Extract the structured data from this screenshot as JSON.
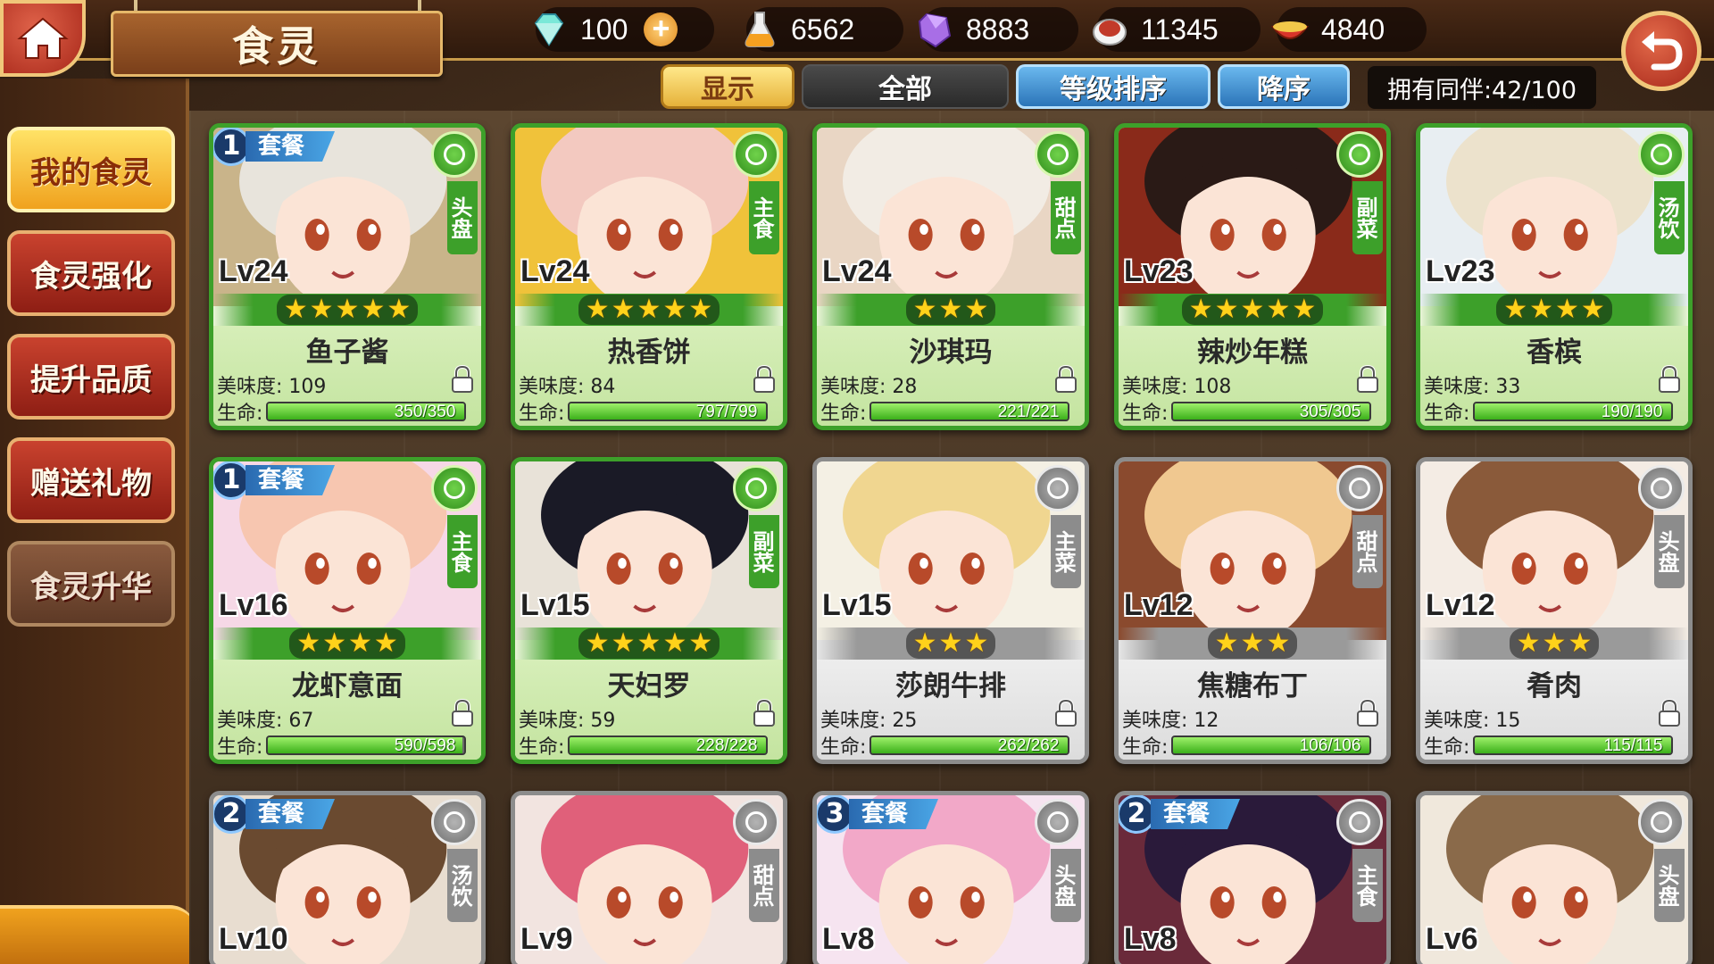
{
  "header": {
    "title": "食灵",
    "currencies": [
      {
        "icon": "diamond-icon",
        "value": "100",
        "has_plus": true
      },
      {
        "icon": "flask-icon",
        "value": "6562"
      },
      {
        "icon": "crystal-icon",
        "value": "8883"
      },
      {
        "icon": "meat-icon",
        "value": "11345"
      },
      {
        "icon": "bowl-icon",
        "value": "4840"
      }
    ],
    "plus_label": "+"
  },
  "filters": {
    "show_label": "显示",
    "all_label": "全部",
    "sort_label": "等级排序",
    "order_label": "降序",
    "owned_label": "拥有同伴:42/100"
  },
  "sidebar": {
    "items": [
      {
        "label": "我的食灵",
        "state": "active"
      },
      {
        "label": "食灵强化",
        "state": "normal"
      },
      {
        "label": "提升品质",
        "state": "normal"
      },
      {
        "label": "赠送礼物",
        "state": "normal"
      },
      {
        "label": "食灵升华",
        "state": "disabled"
      }
    ]
  },
  "labels": {
    "taste": "美味度:",
    "hp": "生命:",
    "set": "套餐"
  },
  "colors": {
    "green_frame": "#3da02a",
    "grey_frame": "#8c8c8c",
    "accent_gold": "#f0a21e",
    "button_red": "#c9422e"
  },
  "cards": [
    {
      "name": "鱼子酱",
      "level": "Lv24",
      "stars": 5,
      "type": "头盘",
      "set": "1",
      "taste": "109",
      "hp": "350/350",
      "hp_fraction": 1.0,
      "frame": "green",
      "hair": "#e8e4dc",
      "bg": "#c9b48a"
    },
    {
      "name": "热香饼",
      "level": "Lv24",
      "stars": 5,
      "type": "主食",
      "set": "",
      "taste": "84",
      "hp": "797/799",
      "hp_fraction": 0.997,
      "frame": "green",
      "hair": "#f3c9c0",
      "bg": "#f0c23a"
    },
    {
      "name": "沙琪玛",
      "level": "Lv24",
      "stars": 3,
      "type": "甜点",
      "set": "",
      "taste": "28",
      "hp": "221/221",
      "hp_fraction": 1.0,
      "frame": "green",
      "hair": "#f2ece4",
      "bg": "#e9d6c4"
    },
    {
      "name": "辣炒年糕",
      "level": "Lv23",
      "stars": 5,
      "type": "副菜",
      "set": "",
      "taste": "108",
      "hp": "305/305",
      "hp_fraction": 1.0,
      "frame": "green",
      "hair": "#2a1a16",
      "bg": "#8a2a1a"
    },
    {
      "name": "香槟",
      "level": "Lv23",
      "stars": 4,
      "type": "汤饮",
      "set": "",
      "taste": "33",
      "hp": "190/190",
      "hp_fraction": 1.0,
      "frame": "green",
      "hair": "#ece2cc",
      "bg": "#e8eef2"
    },
    {
      "name": "龙虾意面",
      "level": "Lv16",
      "stars": 4,
      "type": "主食",
      "set": "1",
      "taste": "67",
      "hp": "590/598",
      "hp_fraction": 0.987,
      "frame": "green",
      "hair": "#f7c6b0",
      "bg": "#f6d8e6"
    },
    {
      "name": "天妇罗",
      "level": "Lv15",
      "stars": 5,
      "type": "副菜",
      "set": "",
      "taste": "59",
      "hp": "228/228",
      "hp_fraction": 1.0,
      "frame": "green",
      "hair": "#1a1a26",
      "bg": "#e8e2d8"
    },
    {
      "name": "莎朗牛排",
      "level": "Lv15",
      "stars": 3,
      "type": "主菜",
      "set": "",
      "taste": "25",
      "hp": "262/262",
      "hp_fraction": 1.0,
      "frame": "grey",
      "hair": "#f0d690",
      "bg": "#f4f0e4"
    },
    {
      "name": "焦糖布丁",
      "level": "Lv12",
      "stars": 3,
      "type": "甜点",
      "set": "",
      "taste": "12",
      "hp": "106/106",
      "hp_fraction": 1.0,
      "frame": "grey",
      "hair": "#f0c890",
      "bg": "#8a4a2e"
    },
    {
      "name": "肴肉",
      "level": "Lv12",
      "stars": 3,
      "type": "头盘",
      "set": "",
      "taste": "15",
      "hp": "115/115",
      "hp_fraction": 1.0,
      "frame": "grey",
      "hair": "#8a5a3a",
      "bg": "#f4ece4"
    },
    {
      "name": "",
      "level": "Lv10",
      "stars": 0,
      "type": "汤饮",
      "set": "2",
      "taste": "",
      "hp": "",
      "hp_fraction": 1.0,
      "frame": "grey",
      "hair": "#6a4a30",
      "bg": "#e8ddd0"
    },
    {
      "name": "",
      "level": "Lv9",
      "stars": 0,
      "type": "甜点",
      "set": "",
      "taste": "",
      "hp": "",
      "hp_fraction": 1.0,
      "frame": "grey",
      "hair": "#e0607a",
      "bg": "#f2e4e0"
    },
    {
      "name": "",
      "level": "Lv8",
      "stars": 0,
      "type": "头盘",
      "set": "3",
      "taste": "",
      "hp": "",
      "hp_fraction": 1.0,
      "frame": "grey",
      "hair": "#f2a8c8",
      "bg": "#f6e4f0"
    },
    {
      "name": "",
      "level": "Lv8",
      "stars": 0,
      "type": "主食",
      "set": "2",
      "taste": "",
      "hp": "",
      "hp_fraction": 1.0,
      "frame": "grey",
      "hair": "#2a1a3a",
      "bg": "#6a2a3a"
    },
    {
      "name": "",
      "level": "Lv6",
      "stars": 0,
      "type": "头盘",
      "set": "",
      "taste": "",
      "hp": "",
      "hp_fraction": 1.0,
      "frame": "grey",
      "hair": "#8a6a4a",
      "bg": "#f0e8dc"
    }
  ]
}
